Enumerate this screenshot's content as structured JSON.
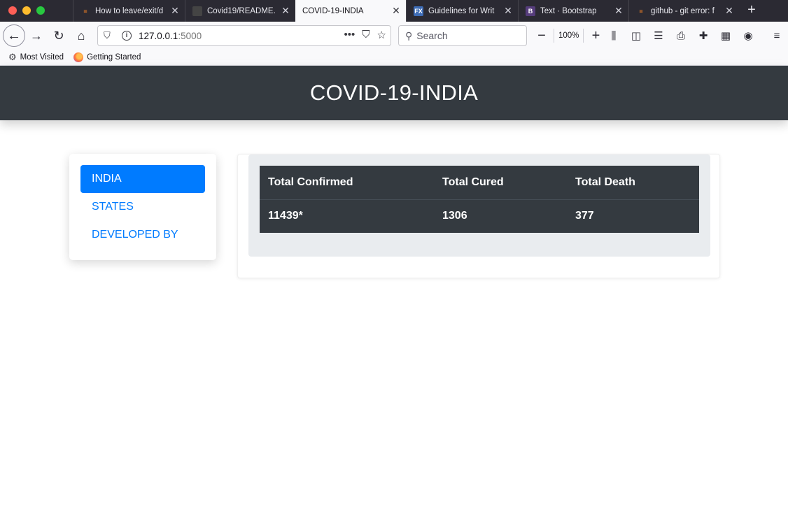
{
  "browser": {
    "tabs": [
      {
        "title": "How to leave/exit/d",
        "icon": "stackoverflow-icon",
        "active": false
      },
      {
        "title": "Covid19/README.m",
        "icon": "github-icon",
        "active": false
      },
      {
        "title": "COVID-19-INDIA",
        "icon": "",
        "active": true
      },
      {
        "title": "Guidelines for Writ",
        "icon": "fx-icon",
        "active": false
      },
      {
        "title": "Text · Bootstrap",
        "icon": "bootstrap-icon",
        "active": false
      },
      {
        "title": "github - git error: f",
        "icon": "stackoverflow-icon",
        "active": false
      }
    ],
    "fav_labels": {
      "fx": "FX",
      "bootstrap": "B"
    },
    "url_host": "127.0.0.1",
    "url_port": ":5000",
    "search_placeholder": "Search",
    "zoom": "100%",
    "bookmarks": [
      "Most Visited",
      "Getting Started"
    ]
  },
  "page": {
    "heading": "COVID-19-INDIA",
    "nav": [
      {
        "label": "INDIA",
        "active": true
      },
      {
        "label": "STATES",
        "active": false
      },
      {
        "label": "DEVELOPED BY",
        "active": false
      }
    ],
    "table": {
      "headers": [
        "Total Confirmed",
        "Total Cured",
        "Total Death"
      ],
      "row": [
        "11439*",
        "1306",
        "377"
      ]
    }
  },
  "colors": {
    "header_bg": "#343a40",
    "primary": "#007bff",
    "well_bg": "#e9ecef"
  }
}
